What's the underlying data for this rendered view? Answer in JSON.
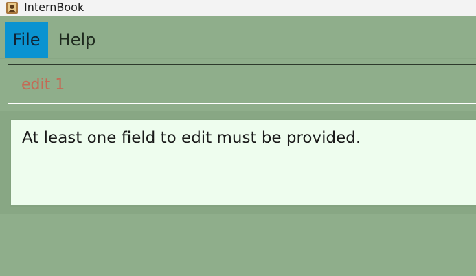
{
  "window": {
    "title": "InternBook",
    "icon": "address-book-icon"
  },
  "menu": {
    "items": [
      {
        "label": "File",
        "active": true
      },
      {
        "label": "Help",
        "active": false
      }
    ]
  },
  "command_box": {
    "value": "edit 1",
    "text_color": "#c46a55"
  },
  "result_display": {
    "message": "At least one field to edit must be provided."
  },
  "colors": {
    "background": "#8fae8b",
    "menu_active": "#0a93d1",
    "result_background": "#eefdee"
  }
}
